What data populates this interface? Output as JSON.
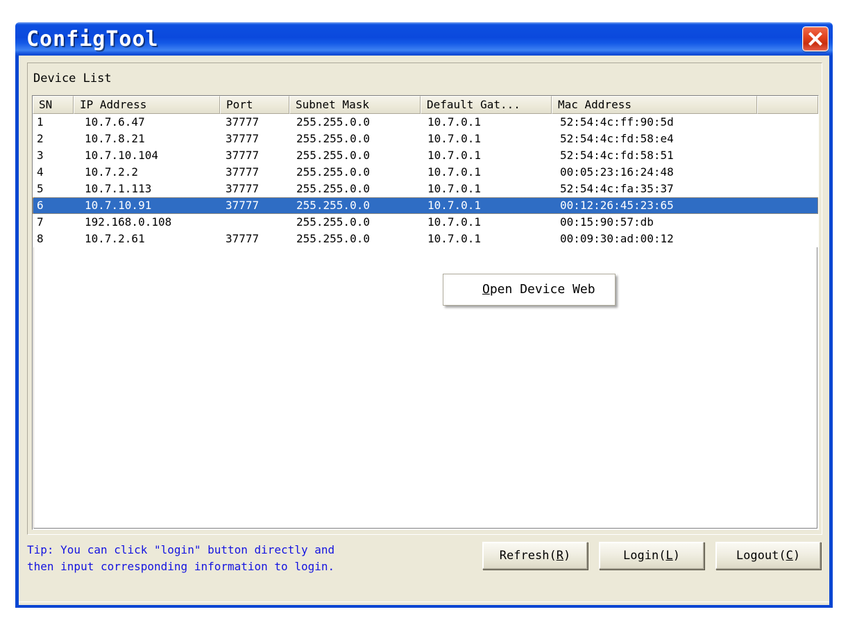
{
  "window": {
    "title": "ConfigTool",
    "close_icon": "close-icon"
  },
  "group": {
    "label": "Device List"
  },
  "table": {
    "columns": [
      "SN",
      "IP Address",
      "Port",
      "Subnet Mask",
      "Default Gat...",
      "Mac Address",
      ""
    ],
    "selected_row_index": 5,
    "rows": [
      {
        "sn": "1",
        "ip": "10.7.6.47",
        "port": "37777",
        "mask": "255.255.0.0",
        "gateway": "10.7.0.1",
        "mac": "52:54:4c:ff:90:5d"
      },
      {
        "sn": "2",
        "ip": "10.7.8.21",
        "port": "37777",
        "mask": "255.255.0.0",
        "gateway": "10.7.0.1",
        "mac": "52:54:4c:fd:58:e4"
      },
      {
        "sn": "3",
        "ip": "10.7.10.104",
        "port": "37777",
        "mask": "255.255.0.0",
        "gateway": "10.7.0.1",
        "mac": "52:54:4c:fd:58:51"
      },
      {
        "sn": "4",
        "ip": "10.7.2.2",
        "port": "37777",
        "mask": "255.255.0.0",
        "gateway": "10.7.0.1",
        "mac": "00:05:23:16:24:48"
      },
      {
        "sn": "5",
        "ip": "10.7.1.113",
        "port": "37777",
        "mask": "255.255.0.0",
        "gateway": "10.7.0.1",
        "mac": "52:54:4c:fa:35:37"
      },
      {
        "sn": "6",
        "ip": "10.7.10.91",
        "port": "37777",
        "mask": "255.255.0.0",
        "gateway": "10.7.0.1",
        "mac": "00:12:26:45:23:65"
      },
      {
        "sn": "7",
        "ip": "192.168.0.108",
        "port": "",
        "mask": "255.255.0.0",
        "gateway": "10.7.0.1",
        "mac": "00:15:90:57:db"
      },
      {
        "sn": "8",
        "ip": "10.7.2.61",
        "port": "37777",
        "mask": "255.255.0.0",
        "gateway": "10.7.0.1",
        "mac": "00:09:30:ad:00:12"
      }
    ]
  },
  "context_menu": {
    "items": [
      {
        "accel": "O",
        "rest": "pen Device Web"
      }
    ]
  },
  "footer": {
    "tip": "Tip: You can click \"login\" button directly and\nthen input corresponding information to login.",
    "buttons": [
      {
        "text_before": "Refresh(",
        "accel": "R",
        "text_after": ")"
      },
      {
        "text_before": "Login(",
        "accel": "L",
        "text_after": ")"
      },
      {
        "text_before": "Logout(",
        "accel": "C",
        "text_after": ")"
      }
    ]
  },
  "colors": {
    "titlebar_blue": "#0b49dd",
    "selection_blue": "#2f6dc4",
    "dialog_face": "#ece9d8",
    "tip_text": "#1414e0",
    "close_red": "#e0401c"
  }
}
